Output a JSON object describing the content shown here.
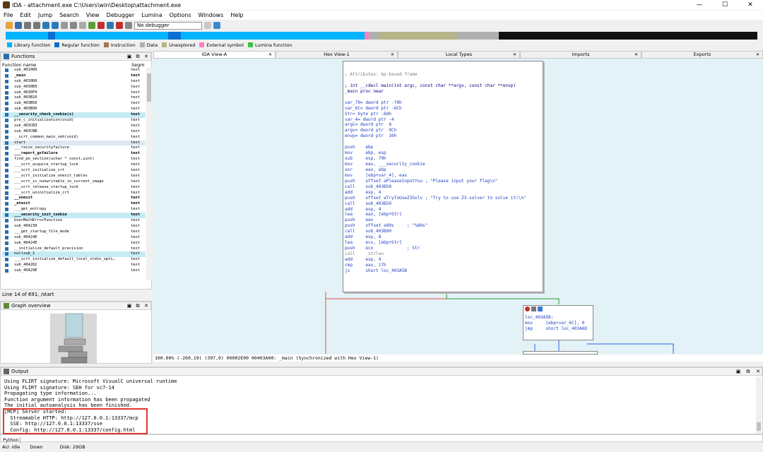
{
  "window": {
    "title": "IDA - attachment.exe C:\\Users\\win\\Desktop\\attachment.exe",
    "minimize": "—",
    "maximize": "☐",
    "close": "✕"
  },
  "menu": [
    "File",
    "Edit",
    "Jump",
    "Search",
    "View",
    "Debugger",
    "Lumina",
    "Options",
    "Windows",
    "Help"
  ],
  "toolbar": {
    "debugger_select": "No debugger"
  },
  "legend": [
    {
      "label": "Library function",
      "color": "#00b4ff"
    },
    {
      "label": "Regular function",
      "color": "#0a6fd1"
    },
    {
      "label": "Instruction",
      "color": "#a07850"
    },
    {
      "label": "Data",
      "color": "#b0b0b0"
    },
    {
      "label": "Unexplored",
      "color": "#b5b58a"
    },
    {
      "label": "External symbol",
      "color": "#ff80c0"
    },
    {
      "label": "Lumina function",
      "color": "#40c040"
    }
  ],
  "functions": {
    "title": "Functions",
    "col_name": "Function name",
    "col_seg": "Segm",
    "rows": [
      {
        "name": "sub_401000",
        "seg": "text",
        "style": ""
      },
      {
        "name": "_main",
        "seg": "text",
        "style": "bold"
      },
      {
        "name": "sub_4030D0",
        "seg": "text",
        "style": ""
      },
      {
        "name": "sub_4030E0",
        "seg": "text",
        "style": ""
      },
      {
        "name": "sub_4030F0",
        "seg": "text",
        "style": ""
      },
      {
        "name": "sub_403B10",
        "seg": "text",
        "style": ""
      },
      {
        "name": "sub_403B50",
        "seg": "text",
        "style": ""
      },
      {
        "name": "sub_403B90",
        "seg": "text",
        "style": ""
      },
      {
        "name": "__security_check_cookie(x)",
        "seg": "text",
        "style": "bold hl"
      },
      {
        "name": "pre_c_initialization(void)",
        "seg": "text",
        "style": ""
      },
      {
        "name": "sub_403CB3",
        "seg": "text",
        "style": ""
      },
      {
        "name": "sub_403CBB",
        "seg": "text",
        "style": ""
      },
      {
        "name": "__scrt_common_main_seh(void)",
        "seg": "text",
        "style": ""
      },
      {
        "name": "start",
        "seg": "text",
        "style": "sel"
      },
      {
        "name": "___raise_securityfailure",
        "seg": "text",
        "style": ""
      },
      {
        "name": "___report_gsfailure",
        "seg": "text",
        "style": "bold"
      },
      {
        "name": "find_pe_section(uchar * const,uint)",
        "seg": "text",
        "style": ""
      },
      {
        "name": "___scrt_acquire_startup_lock",
        "seg": "text",
        "style": ""
      },
      {
        "name": "___scrt_initialize_crt",
        "seg": "text",
        "style": ""
      },
      {
        "name": "___scrt_initialize_onexit_tables",
        "seg": "text",
        "style": ""
      },
      {
        "name": "___scrt_is_nonwritable_in_current_image",
        "seg": "text",
        "style": ""
      },
      {
        "name": "___scrt_release_startup_lock",
        "seg": "text",
        "style": ""
      },
      {
        "name": "___scrt_uninitialize_crt",
        "seg": "text",
        "style": ""
      },
      {
        "name": "__onexit",
        "seg": "text",
        "style": "bold"
      },
      {
        "name": "_atexit",
        "seg": "text",
        "style": "bold"
      },
      {
        "name": "___get_entropy",
        "seg": "text",
        "style": ""
      },
      {
        "name": "___security_init_cookie",
        "seg": "text",
        "style": "bold hl"
      },
      {
        "name": "UserMathErrorFunction",
        "seg": "text",
        "style": ""
      },
      {
        "name": "sub_404230",
        "seg": "text",
        "style": ""
      },
      {
        "name": "___get_startup_file_mode",
        "seg": "text",
        "style": ""
      },
      {
        "name": "sub_40424E",
        "seg": "text",
        "style": ""
      },
      {
        "name": "sub_40424E",
        "seg": "text",
        "style": ""
      },
      {
        "name": "__initialize_default_precision",
        "seg": "text",
        "style": ""
      },
      {
        "name": "nullsub_1",
        "seg": "text",
        "style": "hl"
      },
      {
        "name": "___scrt_initialize_default_local_stdio_opti…",
        "seg": "text",
        "style": ""
      },
      {
        "name": "sub_404282",
        "seg": "text",
        "style": ""
      },
      {
        "name": "sub_40429E",
        "seg": "text",
        "style": ""
      }
    ],
    "status": "Line 14 of 691, /start"
  },
  "graph_overview": {
    "title": "Graph overview"
  },
  "tabs": [
    {
      "label": "IDA View-A",
      "active": true
    },
    {
      "label": "Hex View-1",
      "active": false
    },
    {
      "label": "Local Types",
      "active": false
    },
    {
      "label": "Imports",
      "active": false
    },
    {
      "label": "Exports",
      "active": false
    }
  ],
  "disasm": {
    "lines": [
      {
        "t": "; Attributes: bp-based frame",
        "c": "c-gray"
      },
      {
        "t": "",
        "c": ""
      },
      {
        "t": "; int __cdecl main(int argc, const char **argv, const char **envp)",
        "c": "c-blue"
      },
      {
        "t": "_main proc near",
        "c": "c-blue"
      },
      {
        "t": "",
        "c": ""
      },
      {
        "t": "var_70= dword ptr -70h",
        "c": "c-navy"
      },
      {
        "t": "var_6C= dword ptr -6Ch",
        "c": "c-navy"
      },
      {
        "t": "Str= byte ptr -68h",
        "c": "c-navy"
      },
      {
        "t": "var_4= dword ptr -4",
        "c": "c-navy"
      },
      {
        "t": "argc= dword ptr  8",
        "c": "c-navy"
      },
      {
        "t": "argv= dword ptr  0Ch",
        "c": "c-navy"
      },
      {
        "t": "envp= dword ptr  10h",
        "c": "c-navy"
      },
      {
        "t": "",
        "c": ""
      },
      {
        "t": "push    ebp",
        "c": "c-navy"
      },
      {
        "t": "mov     ebp, esp",
        "c": "c-navy"
      },
      {
        "t": "sub     esp, 70h",
        "c": "c-navy"
      },
      {
        "t": "mov     eax, ___security_cookie",
        "c": "c-navy"
      },
      {
        "t": "xor     eax, ebp",
        "c": "c-navy"
      },
      {
        "t": "mov     [ebp+var_4], eax",
        "c": "c-navy"
      },
      {
        "t": "push    offset aPleaseInputYou ; \"Please input your flag\\n\"",
        "c": "c-navy"
      },
      {
        "t": "call    sub_403B50",
        "c": "c-navy"
      },
      {
        "t": "add     esp, 4",
        "c": "c-navy"
      },
      {
        "t": "push    offset aTryToUseZ3Solv ; \"Try to use Z3-solver to solve it!\\n\"",
        "c": "c-navy"
      },
      {
        "t": "call    sub_403B50",
        "c": "c-navy"
      },
      {
        "t": "add     esp, 4",
        "c": "c-navy"
      },
      {
        "t": "lea     eax, [ebp+Str]",
        "c": "c-navy"
      },
      {
        "t": "push    eax",
        "c": "c-navy"
      },
      {
        "t": "push    offset a80s     ; \"%80s\"",
        "c": "c-navy"
      },
      {
        "t": "call    sub_403B90",
        "c": "c-navy"
      },
      {
        "t": "add     esp, 8",
        "c": "c-navy"
      },
      {
        "t": "lea     ecx, [ebp+Str]",
        "c": "c-navy"
      },
      {
        "t": "push    ecx             ; Str",
        "c": "c-navy"
      },
      {
        "t": "call    _strlen",
        "c": "c-gray"
      },
      {
        "t": "add     esp, 4",
        "c": "c-navy"
      },
      {
        "t": "cmp     eax, 17h",
        "c": "c-navy"
      },
      {
        "t": "jz      short loc_403A5B",
        "c": "c-navy"
      }
    ],
    "block2": [
      {
        "t": "loc_403A5B:",
        "c": "c-navy"
      },
      {
        "t": "mov     [ebp+var_6C], 0",
        "c": "c-navy"
      },
      {
        "t": "jmp     short loc_403A6D",
        "c": "c-navy"
      }
    ],
    "status": "100.00% (-260,19) (397,0) 00002E00 00403A00: _main (Synchronized with Hex View-1)"
  },
  "output": {
    "title": "Output",
    "lines": [
      "Using FLIRT signature: Microsoft VisualC universal runtime",
      "Using FLIRT signature: SEH for vc7-14",
      "Propagating type information...",
      "Function argument information has been propagated",
      "The initial autoanalysis has been finished.",
      "[MCP] Server started:",
      "  Streamable HTTP: http://127.0.0.1:13337/mcp",
      "  SSE: http://127.0.0.1:13337/sse",
      "  Config: http://127.0.0.1:13337/config.html"
    ]
  },
  "python_label": "Python",
  "statusbar": {
    "au": "AU:",
    "state": "idle",
    "dir": "Down",
    "disk": "Disk: 29GB"
  }
}
